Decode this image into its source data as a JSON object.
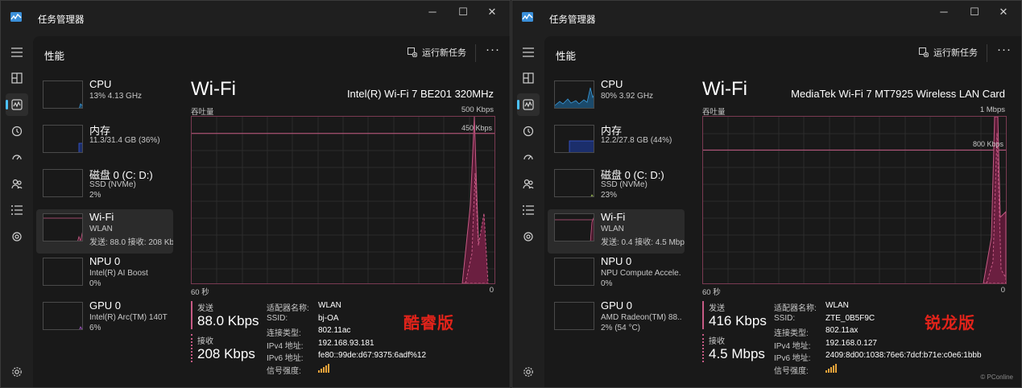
{
  "left": {
    "window_title": "任务管理器",
    "header_title": "性能",
    "run_new_task": "运行新任务",
    "more": "···",
    "sidebar": [
      {
        "name": "CPU",
        "sub": "13% 4.13 GHz",
        "sub2": ""
      },
      {
        "name": "内存",
        "sub": "11.3/31.4 GB (36%)",
        "sub2": ""
      },
      {
        "name": "磁盘 0 (C: D:)",
        "sub": "SSD (NVMe)",
        "sub2": "2%"
      },
      {
        "name": "Wi-Fi",
        "sub": "WLAN",
        "sub2": "发送: 88.0 接收: 208 Kbps"
      },
      {
        "name": "NPU 0",
        "sub": "Intel(R) AI Boost",
        "sub2": "0%"
      },
      {
        "name": "GPU 0",
        "sub": "Intel(R) Arc(TM) 140T",
        "sub2": "6%"
      }
    ],
    "panel_title": "Wi-Fi",
    "adapter": "Intel(R) Wi-Fi 7 BE201 320MHz",
    "throughput_label": "吞吐量",
    "max_label": "500 Kbps",
    "ref_label": "450 Kbps",
    "x_left": "60 秒",
    "x_right": "0",
    "send_label": "发送",
    "send_value": "88.0 Kbps",
    "recv_label": "接收",
    "recv_value": "208 Kbps",
    "props": [
      {
        "k": "适配器名称:",
        "v": "WLAN"
      },
      {
        "k": "SSID:",
        "v": "bj-OA"
      },
      {
        "k": "连接类型:",
        "v": "802.11ac"
      },
      {
        "k": "IPv4 地址:",
        "v": "192.168.93.181"
      },
      {
        "k": "IPv6 地址:",
        "v": "fe80::99de:d67:9375:6adf%12"
      },
      {
        "k": "信号强度:",
        "v": ""
      }
    ],
    "edition": "酷睿版"
  },
  "right": {
    "window_title": "任务管理器",
    "header_title": "性能",
    "run_new_task": "运行新任务",
    "more": "···",
    "sidebar": [
      {
        "name": "CPU",
        "sub": "80% 3.92 GHz",
        "sub2": ""
      },
      {
        "name": "内存",
        "sub": "12.2/27.8 GB (44%)",
        "sub2": ""
      },
      {
        "name": "磁盘 0 (C: D:)",
        "sub": "SSD (NVMe)",
        "sub2": "23%"
      },
      {
        "name": "Wi-Fi",
        "sub": "WLAN",
        "sub2": "发送: 0.4 接收: 4.5 Mbps"
      },
      {
        "name": "NPU 0",
        "sub": "NPU Compute Accele.",
        "sub2": "0%"
      },
      {
        "name": "GPU 0",
        "sub": "AMD Radeon(TM) 88..",
        "sub2": "2% (54 °C)"
      }
    ],
    "panel_title": "Wi-Fi",
    "adapter": "MediaTek Wi-Fi 7 MT7925 Wireless LAN Card",
    "throughput_label": "吞吐量",
    "max_label": "1 Mbps",
    "ref_label": "800 Kbps",
    "x_left": "60 秒",
    "x_right": "0",
    "send_label": "发送",
    "send_value": "416 Kbps",
    "recv_label": "接收",
    "recv_value": "4.5 Mbps",
    "props": [
      {
        "k": "适配器名称:",
        "v": "WLAN"
      },
      {
        "k": "SSID:",
        "v": "ZTE_0B5F9C"
      },
      {
        "k": "连接类型:",
        "v": "802.11ax"
      },
      {
        "k": "IPv4 地址:",
        "v": "192.168.0.127"
      },
      {
        "k": "IPv6 地址:",
        "v": "2409:8d00:1038:76e6:7dcf:b71e:c0e6:1bbb"
      },
      {
        "k": "信号强度:",
        "v": ""
      }
    ],
    "edition": "锐龙版",
    "watermark": "© PConline"
  },
  "colors": {
    "accent": "#4cc2ff",
    "wifi_line": "#c65a84",
    "edition_red": "#e2231a"
  }
}
